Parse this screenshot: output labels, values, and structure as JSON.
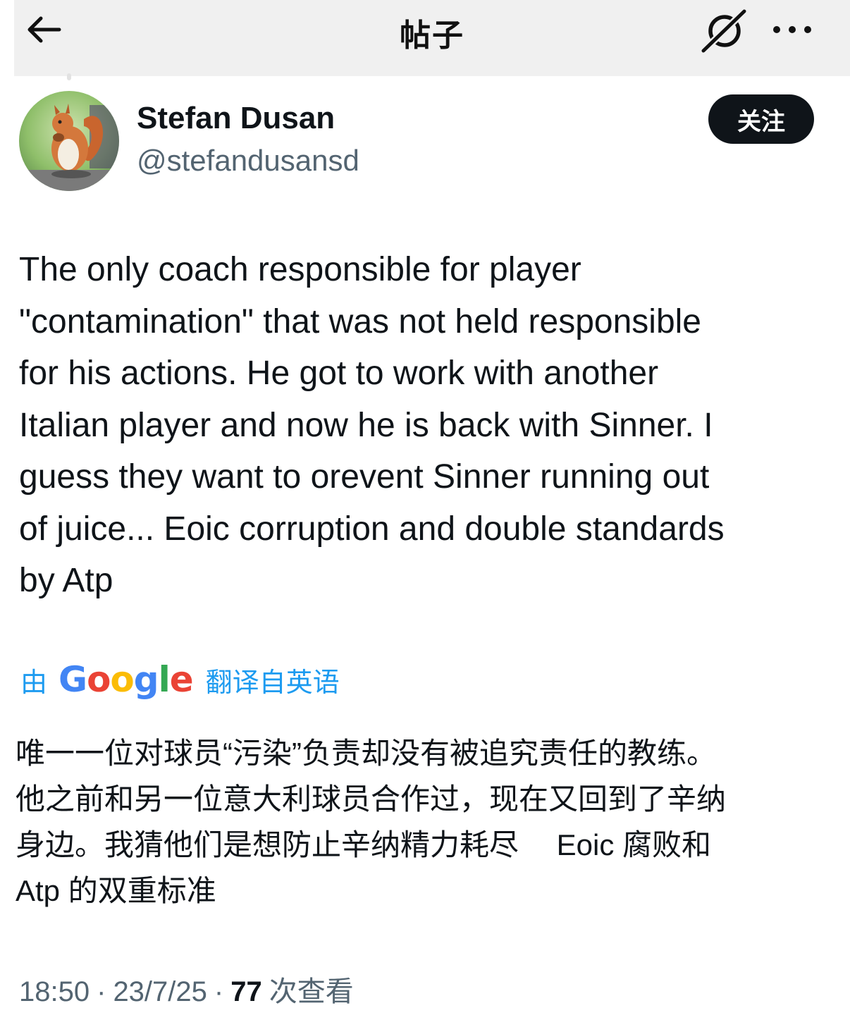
{
  "nav": {
    "title": "帖子",
    "back_icon": "arrow-left-icon",
    "grok_icon": "grok-icon",
    "more_icon": "more-horizontal-icon"
  },
  "author": {
    "display_name": "Stefan Dusan",
    "handle": "@stefandusansd",
    "follow_label": "关注",
    "avatar_icon": "squirrel-painting-avatar"
  },
  "post": {
    "lines": [
      "The only coach responsible for player",
      "\"contamination\" that was not held responsible",
      "for his actions. He got to work with another",
      "Italian player and now he is back with Sinner. I",
      "guess they want to orevent Sinner running out",
      "of juice... Eoic corruption and double standards",
      "by Atp"
    ]
  },
  "translation": {
    "by_label": "由",
    "provider": "Google",
    "suffix_label": "翻译自英语",
    "lines": [
      "唯一一位对球员“污染”负责却没有被追究责任的教练。",
      "他之前和另一位意大利球员合作过，现在又回到了辛纳",
      "身边。我猜他们是想防止辛纳精力耗尽　 Eoic 腐败和",
      "Atp 的双重标准"
    ]
  },
  "meta": {
    "time": "18:50",
    "separator": "·",
    "date": "23/7/25",
    "views_count": "77",
    "views_label": "次查看"
  },
  "colors": {
    "text_primary": "#0f1419",
    "text_secondary": "#536471",
    "link_blue": "#1d9bf0",
    "topbar_bg": "#f0f0f0",
    "follow_bg": "#0f1419"
  }
}
